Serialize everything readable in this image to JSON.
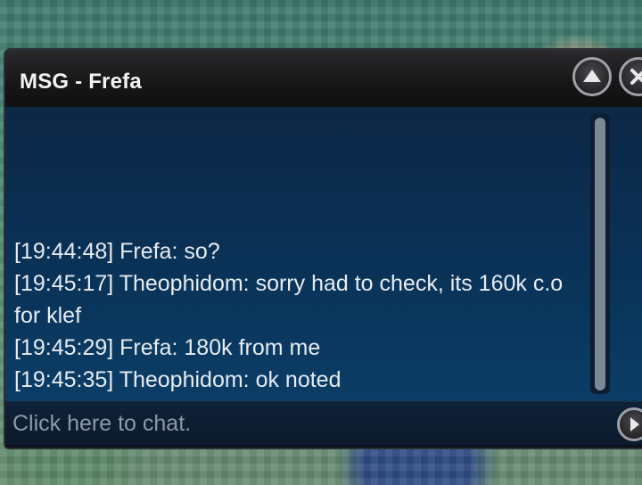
{
  "window": {
    "title": "MSG - Frefa"
  },
  "messages": [
    "[19:44:48] Frefa: so?",
    "[19:45:17] Theophidom: sorry had to check, its 160k c.o for klef",
    "[19:45:29] Frefa: 180k from me",
    "[19:45:35] Theophidom: ok noted"
  ],
  "input": {
    "placeholder": "Click here to chat."
  },
  "icons": {
    "minimize": "chevron-up-icon",
    "close": "close-icon",
    "send": "chevron-right-icon"
  }
}
